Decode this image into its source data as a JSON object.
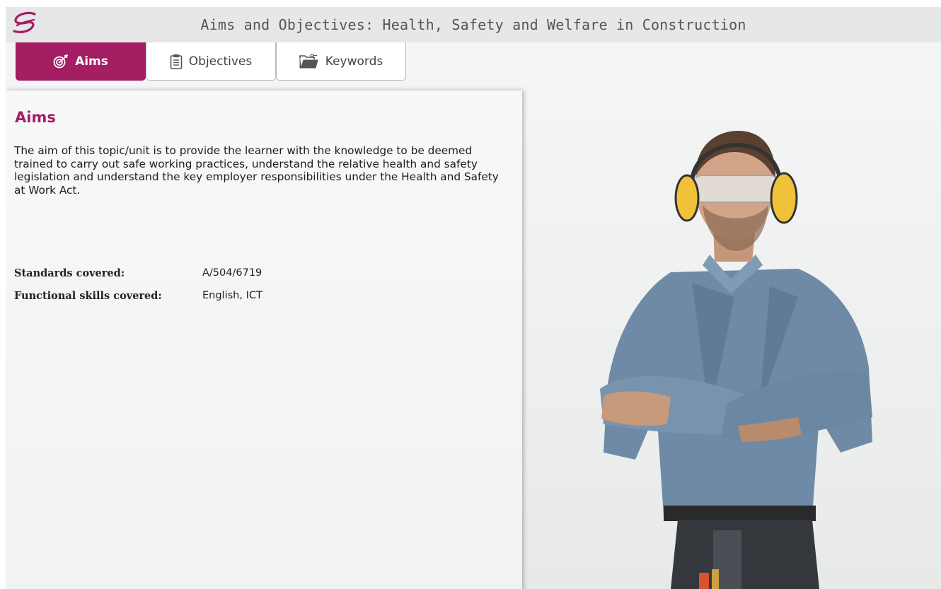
{
  "app": {
    "title": "Aims and Objectives: Health, Safety and Welfare in Construction"
  },
  "tabs": [
    {
      "label": "Aims",
      "icon": "target-icon",
      "active": true
    },
    {
      "label": "Objectives",
      "icon": "clipboard-icon",
      "active": false
    },
    {
      "label": "Keywords",
      "icon": "folder-key-icon",
      "active": false
    }
  ],
  "panel": {
    "heading": "Aims",
    "body": "The aim of this topic/unit is to provide the learner with the knowledge to be deemed trained to carry out safe working practices, understand the relative health and safety legislation and understand the key employer responsibilities under the Health and Safety at Work Act.",
    "standards_label": "Standards covered:",
    "standards_value": "A/504/6719",
    "skills_label": "Functional skills covered:",
    "skills_value": "English, ICT"
  },
  "colors": {
    "accent": "#a31e63",
    "titlebar": "#e6e7e8"
  }
}
